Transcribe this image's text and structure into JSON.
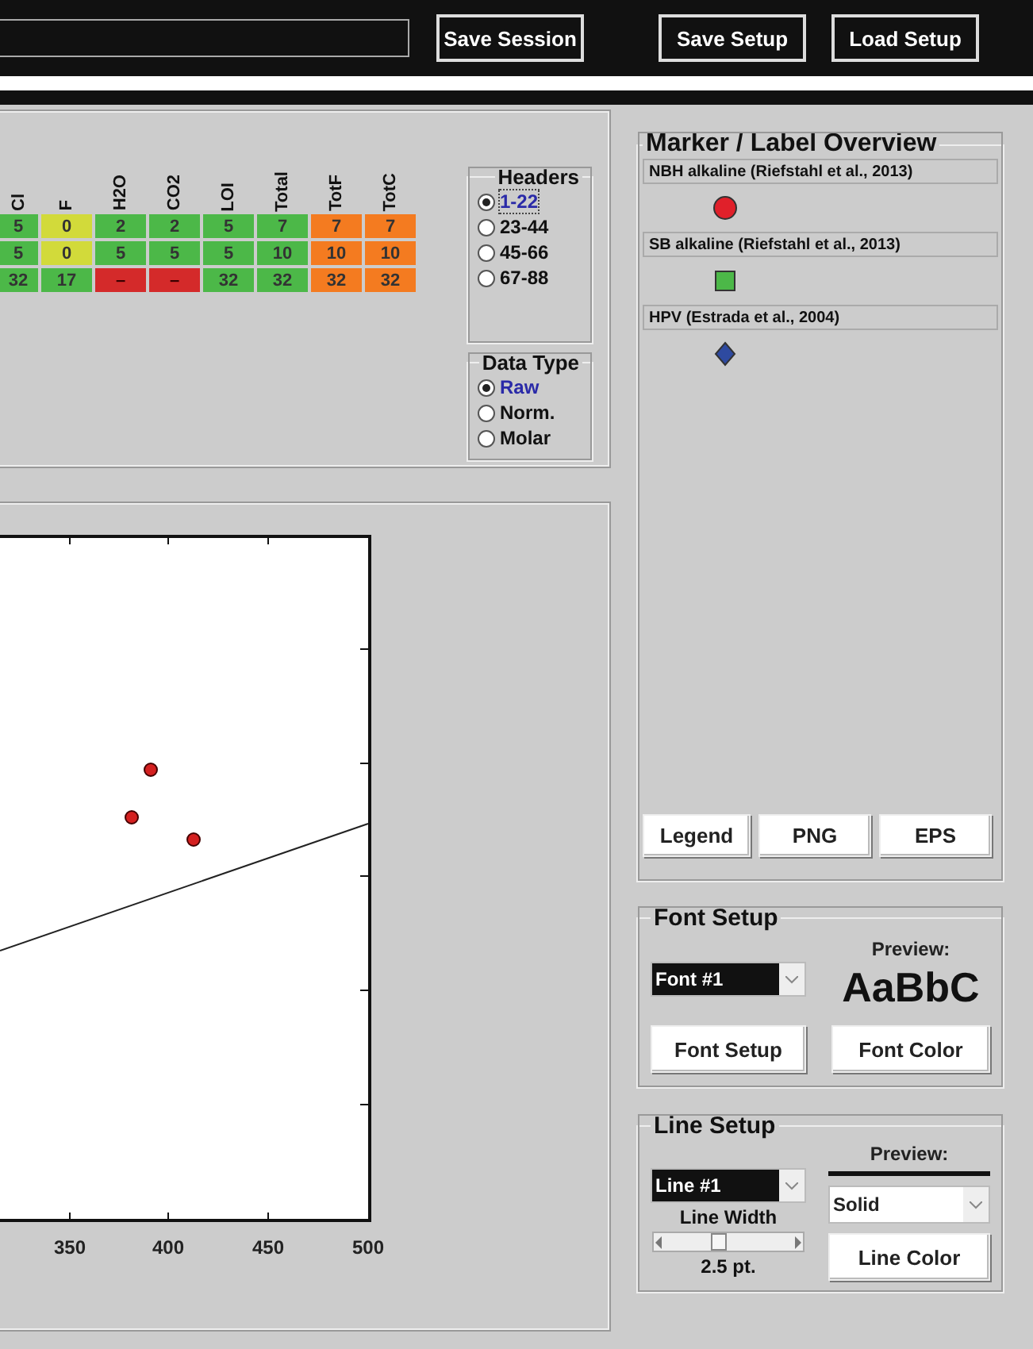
{
  "toolbar": {
    "buttons": [
      "Save Session",
      "Save Setup",
      "Load Setup"
    ]
  },
  "table": {
    "columns": [
      "Cl",
      "F",
      "H2O",
      "CO2",
      "LOI",
      "Total",
      "TotF",
      "TotC"
    ],
    "rows": [
      {
        "cells": [
          {
            "text": "5",
            "color": "#4cb848"
          },
          {
            "text": "0",
            "color": "#d2da3a"
          },
          {
            "text": "2",
            "color": "#4cb848"
          },
          {
            "text": "2",
            "color": "#4cb848"
          },
          {
            "text": "5",
            "color": "#4cb848"
          },
          {
            "text": "7",
            "color": "#4cb848"
          },
          {
            "text": "7",
            "color": "#f47b20"
          },
          {
            "text": "7",
            "color": "#f47b20"
          }
        ]
      },
      {
        "cells": [
          {
            "text": "5",
            "color": "#4cb848"
          },
          {
            "text": "0",
            "color": "#d2da3a"
          },
          {
            "text": "5",
            "color": "#4cb848"
          },
          {
            "text": "5",
            "color": "#4cb848"
          },
          {
            "text": "5",
            "color": "#4cb848"
          },
          {
            "text": "10",
            "color": "#4cb848"
          },
          {
            "text": "10",
            "color": "#f47b20"
          },
          {
            "text": "10",
            "color": "#f47b20"
          }
        ]
      },
      {
        "cells": [
          {
            "text": "32",
            "color": "#4cb848"
          },
          {
            "text": "17",
            "color": "#4cb848"
          },
          {
            "text": "–",
            "color": "#d42a2a"
          },
          {
            "text": "–",
            "color": "#d42a2a"
          },
          {
            "text": "32",
            "color": "#4cb848"
          },
          {
            "text": "32",
            "color": "#4cb848"
          },
          {
            "text": "32",
            "color": "#f47b20"
          },
          {
            "text": "32",
            "color": "#f47b20"
          }
        ]
      }
    ]
  },
  "headers": {
    "title": "Headers",
    "options": [
      {
        "label": "1-22",
        "selected": true
      },
      {
        "label": "23-44",
        "selected": false
      },
      {
        "label": "45-66",
        "selected": false
      },
      {
        "label": "67-88",
        "selected": false
      }
    ]
  },
  "data_type": {
    "title": "Data Type",
    "options": [
      {
        "label": "Raw",
        "selected": true
      },
      {
        "label": "Norm.",
        "selected": false
      },
      {
        "label": "Molar",
        "selected": false
      }
    ]
  },
  "plot": {
    "x_tick_labels": [
      "350",
      "400",
      "450",
      "500"
    ]
  },
  "marker_overview": {
    "title": "Marker / Label Overview",
    "items": [
      {
        "label": "NBH alkaline (Riefstahl et al., 2013)",
        "kind": "circle",
        "color": "#e0202a"
      },
      {
        "label": "SB alkaline (Riefstahl et al., 2013)",
        "kind": "square",
        "color": "#4cb848"
      },
      {
        "label": "HPV (Estrada et al., 2004)",
        "kind": "diamond",
        "color": "#2e4aa0"
      }
    ],
    "buttons": [
      "Legend",
      "PNG",
      "EPS"
    ]
  },
  "font_setup": {
    "title": "Font Setup",
    "dropdown": "Font #1",
    "preview_label": "Preview:",
    "preview_text": "AaBbC",
    "buttons": [
      "Font Setup",
      "Font Color"
    ]
  },
  "line_setup": {
    "title": "Line Setup",
    "dropdown": "Line #1",
    "width_label": "Line Width",
    "width_slider": {
      "level": 0.4
    },
    "width_value": "2.5 pt.",
    "preview_label": "Preview:",
    "style_dropdown": "Solid",
    "button": "Line Color"
  }
}
